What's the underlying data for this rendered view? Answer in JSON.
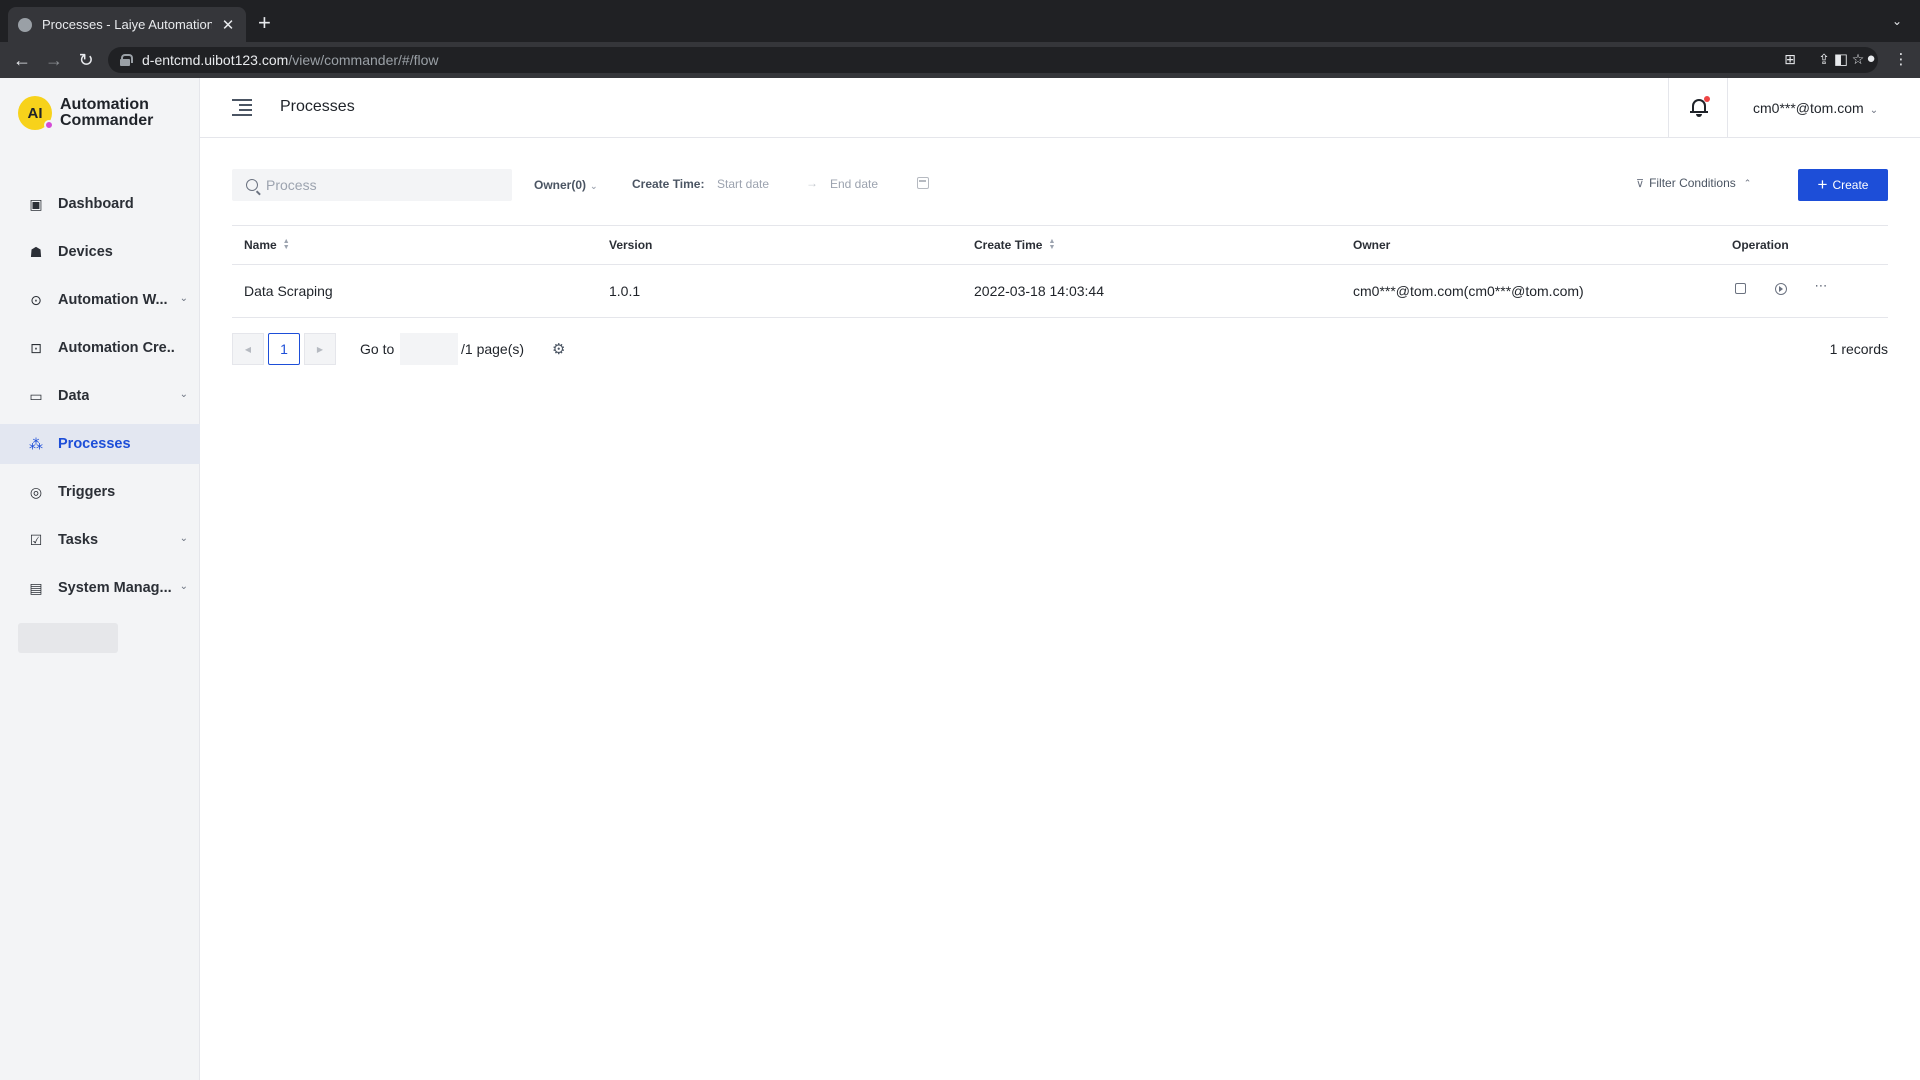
{
  "browser": {
    "tab_title": "Processes - Laiye Automation",
    "url_host": "d-entcmd.uibot123.com",
    "url_path": "/view/commander/#/flow"
  },
  "sidebar": {
    "logo_line1": "Automation",
    "logo_line2": "Commander",
    "items": [
      {
        "label": "Dashboard",
        "icon": "dashboard-icon"
      },
      {
        "label": "Devices",
        "icon": "devices-icon"
      },
      {
        "label": "Automation W...",
        "icon": "workflow-icon"
      },
      {
        "label": "Automation Cre...",
        "icon": "creator-icon"
      },
      {
        "label": "Data",
        "icon": "folder-icon"
      },
      {
        "label": "Processes",
        "icon": "processes-icon"
      },
      {
        "label": "Triggers",
        "icon": "trigger-icon"
      },
      {
        "label": "Tasks",
        "icon": "tasks-icon"
      },
      {
        "label": "System Manag...",
        "icon": "system-icon"
      }
    ],
    "active": "Processes"
  },
  "header": {
    "title": "Processes",
    "user": "cm0***@tom.com"
  },
  "filters": {
    "search_placeholder": "Process",
    "owner_label": "Owner(0)",
    "create_time_label": "Create Time:",
    "start_placeholder": "Start date",
    "end_placeholder": "End date",
    "filter_conditions": "Filter Conditions",
    "create_label": "Create"
  },
  "table": {
    "columns": [
      "Name",
      "Version",
      "Create Time",
      "Owner",
      "Operation"
    ],
    "rows": [
      {
        "name": "Data Scraping",
        "version": "1.0.1",
        "create_time": "2022-03-18 14:03:44",
        "owner": "cm0***@tom.com(cm0***@tom.com)"
      }
    ]
  },
  "pagination": {
    "current_page": "1",
    "goto_label": "Go to",
    "pages_label": "/1 page(s)",
    "records": "1 records"
  },
  "colors": {
    "accent": "#1d4ed8",
    "sidebar_bg": "#f3f4f6",
    "logo_yellow": "#f7d21b"
  }
}
